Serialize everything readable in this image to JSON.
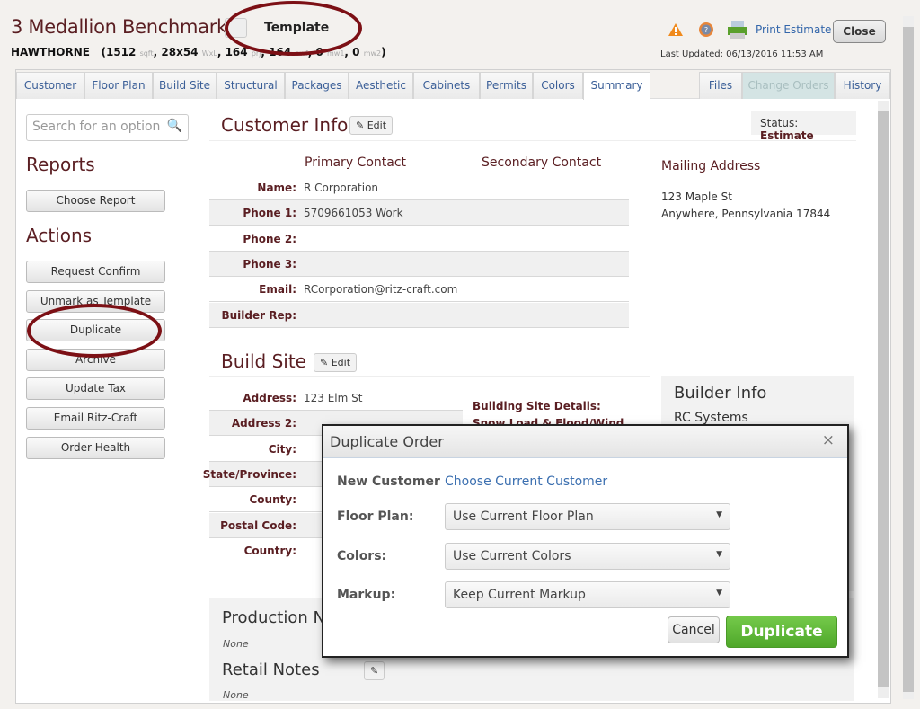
{
  "header": {
    "title": "3 Medallion Benchmark",
    "template_label": "Template",
    "model": "HAWTHORNE",
    "specs": [
      [
        "1512",
        "sqft"
      ],
      [
        "28x54",
        "WxL"
      ],
      [
        "164",
        "prj"
      ],
      [
        "164",
        "ewf"
      ],
      [
        "0",
        "mw1"
      ],
      [
        "0",
        "mw2"
      ]
    ],
    "print_label": "Print Estimate",
    "close_label": "Close",
    "last_updated": "Last Updated: 06/13/2016 11:53 AM"
  },
  "tabs": [
    "Customer",
    "Floor Plan",
    "Build Site",
    "Structural",
    "Packages",
    "Aesthetic",
    "Cabinets",
    "Permits",
    "Colors",
    "Summary"
  ],
  "active_tab": "Summary",
  "right_tabs": [
    "Files",
    "Change Orders",
    "History"
  ],
  "sidebar": {
    "search_placeholder": "Search for an option",
    "reports_title": "Reports",
    "reports": [
      "Choose Report"
    ],
    "actions_title": "Actions",
    "actions": [
      "Request Confirm",
      "Unmark as Template",
      "Duplicate",
      "Archive",
      "Update Tax",
      "Email Ritz-Craft",
      "Order Health"
    ]
  },
  "status": {
    "label": "Status:",
    "value": "Estimate"
  },
  "customer_info": {
    "title": "Customer Info",
    "edit": "Edit",
    "primary": "Primary Contact",
    "secondary": "Secondary Contact",
    "rows": [
      {
        "label": "Name:",
        "value": "R Corporation"
      },
      {
        "label": "Phone 1:",
        "value": "5709661053  Work"
      },
      {
        "label": "Phone 2:",
        "value": ""
      },
      {
        "label": "Phone 3:",
        "value": ""
      },
      {
        "label": "Email:",
        "value": "RCorporation@ritz-craft.com"
      },
      {
        "label": "Builder Rep:",
        "value": ""
      }
    ],
    "mailing_title": "Mailing Address",
    "mailing_line1": "123 Maple St",
    "mailing_line2": "Anywhere, Pennsylvania 17844"
  },
  "build_site": {
    "title": "Build Site",
    "edit": "Edit",
    "rows": [
      {
        "label": "Address:",
        "value": "123 Elm St"
      },
      {
        "label": "Address 2:",
        "value": ""
      },
      {
        "label": "City:",
        "value": ""
      },
      {
        "label": "State/Province:",
        "value": ""
      },
      {
        "label": "County:",
        "value": ""
      },
      {
        "label": "Postal Code:",
        "value": ""
      },
      {
        "label": "Country:",
        "value": ""
      }
    ],
    "details_title": "Building Site Details:",
    "details_line": "Snow Load & Flood/Wind"
  },
  "builder_info": {
    "title": "Builder Info",
    "name": "RC Systems"
  },
  "notes": {
    "production_title": "Production Notes",
    "production_value": "None",
    "retail_title": "Retail Notes",
    "retail_value": "None"
  },
  "dialog": {
    "title": "Duplicate Order",
    "close": "×",
    "new_customer_label": "New Customer",
    "new_customer_link": "Choose Current Customer",
    "fields": [
      {
        "label": "Floor Plan:",
        "value": "Use Current Floor Plan"
      },
      {
        "label": "Colors:",
        "value": "Use Current Colors"
      },
      {
        "label": "Markup:",
        "value": "Keep Current Markup"
      }
    ],
    "cancel": "Cancel",
    "submit": "Duplicate"
  },
  "colors": {
    "brand": "#5a1e22",
    "link": "#3b5f98",
    "success": "#5cb531",
    "highlight": "#7c1015"
  }
}
